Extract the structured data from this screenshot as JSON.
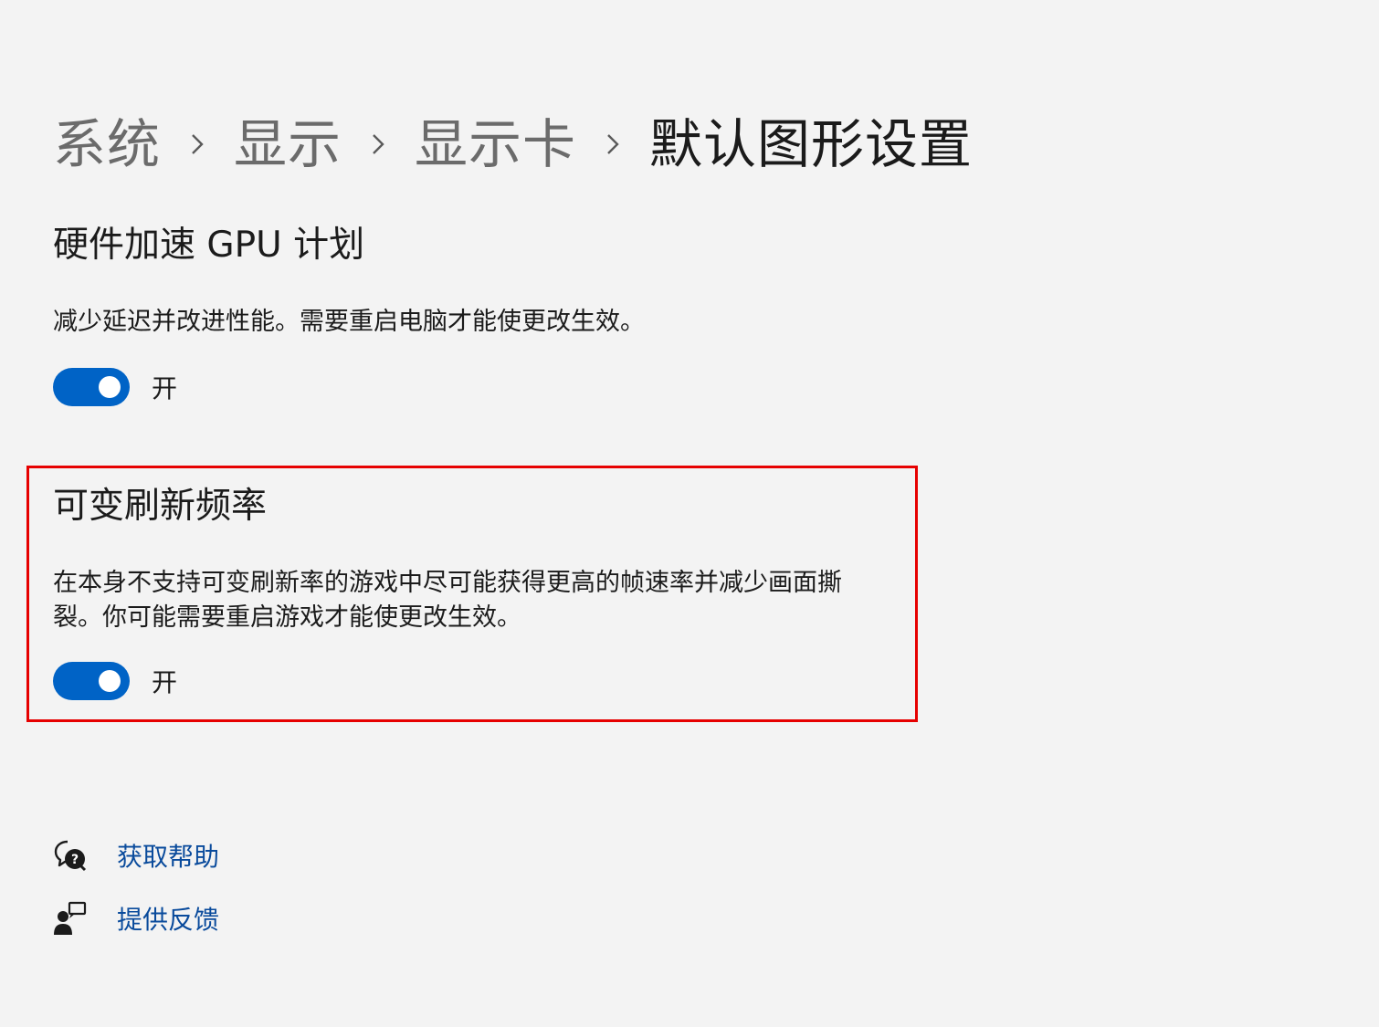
{
  "breadcrumb": {
    "items": [
      "系统",
      "显示",
      "显示卡",
      "默认图形设置"
    ]
  },
  "hardware_gpu": {
    "title": "硬件加速 GPU 计划",
    "description": "减少延迟并改进性能。需要重启电脑才能使更改生效。",
    "toggle_state": "on",
    "toggle_label": "开"
  },
  "variable_refresh": {
    "title": "可变刷新频率",
    "description_line1": "在本身不支持可变刷新率的游戏中尽可能获得更高的帧速率并减少画面撕",
    "description_line2": "裂。你可能需要重启游戏才能使更改生效。",
    "toggle_state": "on",
    "toggle_label": "开"
  },
  "links": {
    "help": "获取帮助",
    "feedback": "提供反馈"
  },
  "colors": {
    "accent": "#0063c6",
    "highlight": "#e60000",
    "link": "#0a4b9c",
    "background": "#f3f3f3"
  }
}
